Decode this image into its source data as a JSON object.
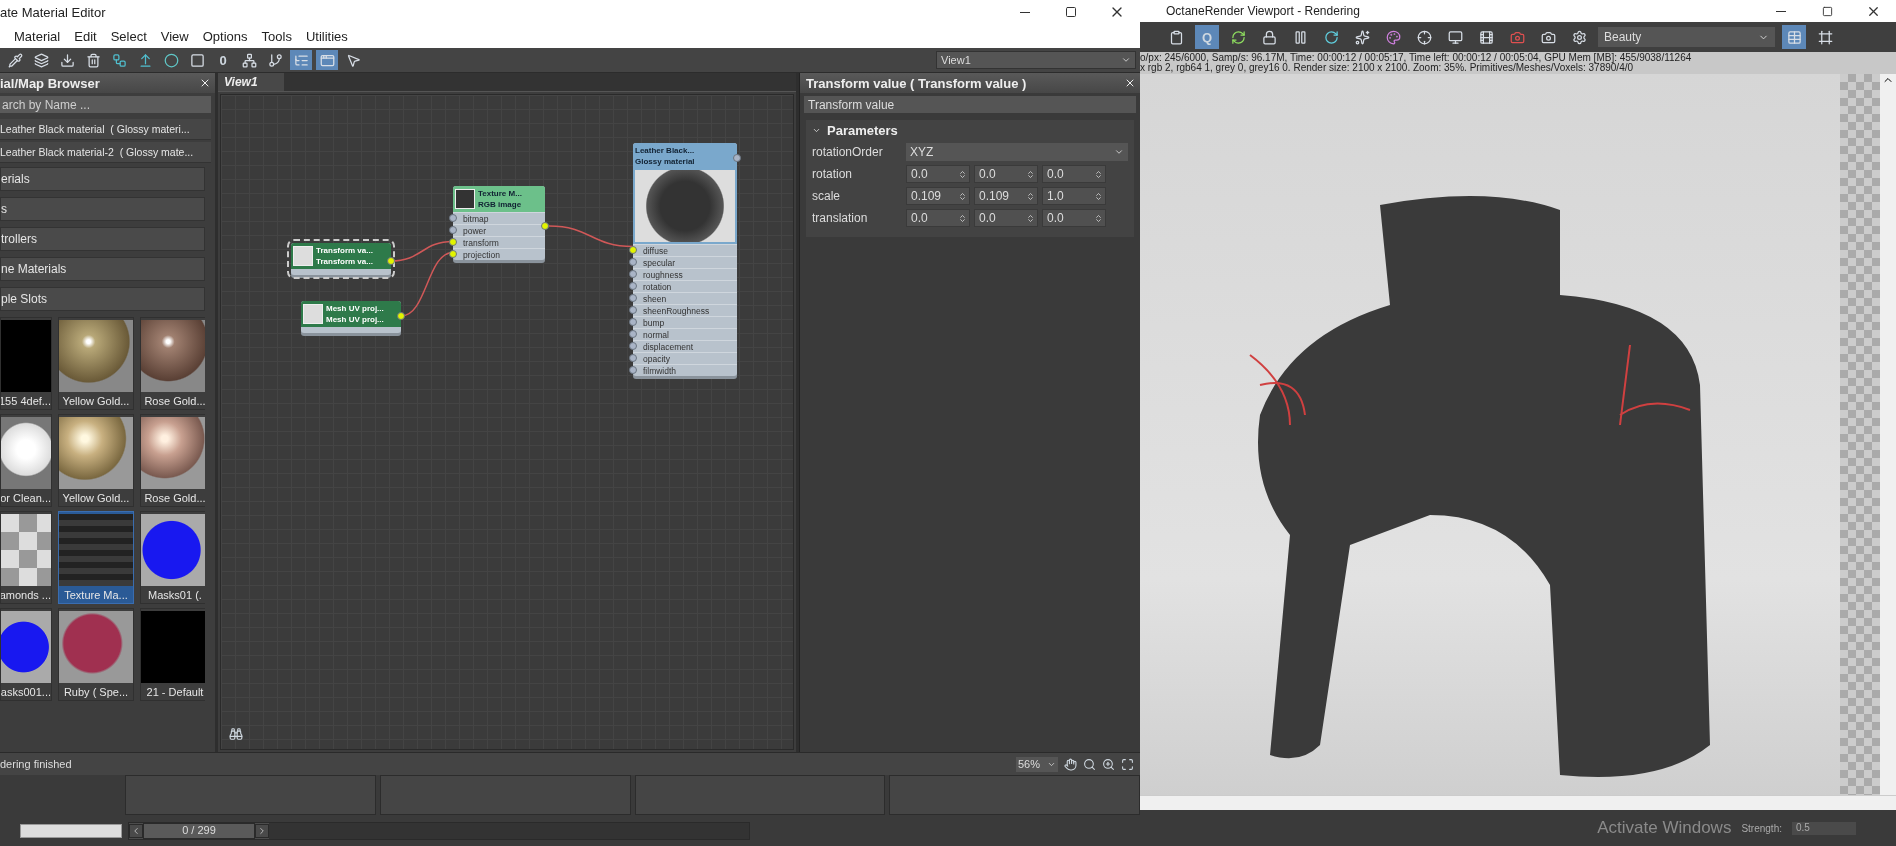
{
  "editor": {
    "title": "ate Material Editor",
    "menu": [
      "Material",
      "Edit",
      "Select",
      "View",
      "Options",
      "Tools",
      "Utilities"
    ],
    "toolbar": [
      {
        "kind": "pipette",
        "selected": false
      },
      {
        "kind": "layers",
        "selected": false
      },
      {
        "kind": "put",
        "selected": false
      },
      {
        "kind": "trash",
        "selected": false
      },
      {
        "kind": "layout",
        "selected": false
      },
      {
        "kind": "lift",
        "selected": false
      },
      {
        "kind": "sphere",
        "selected": false
      },
      {
        "kind": "dark",
        "selected": false
      },
      {
        "kind": "zero",
        "label": "0",
        "selected": false
      },
      {
        "kind": "nodes",
        "selected": false
      },
      {
        "kind": "branch",
        "selected": false
      },
      {
        "kind": "list",
        "selected": true
      },
      {
        "kind": "window",
        "selected": true
      },
      {
        "kind": "checker",
        "selected": false
      }
    ],
    "view_select": "View1",
    "browser": {
      "title": "ial/Map Browser",
      "placeholder": "arch by Name ...",
      "items": [
        "Leather Black material  ( Glossy materi...",
        "Leather Black material-2  ( Glossy mate..."
      ],
      "rollouts": [
        "erials",
        "s",
        "trollers",
        "ne Materials",
        "ple Slots"
      ],
      "slots": [
        {
          "label": "155 4def...",
          "kind": "black",
          "selected": false
        },
        {
          "label": "Yellow Gold...",
          "kind": "gold-chrome",
          "selected": false
        },
        {
          "label": "Rose Gold...",
          "kind": "rose-chrome",
          "selected": false
        },
        {
          "label": "or Clean...",
          "kind": "white",
          "selected": false
        },
        {
          "label": "Yellow Gold...",
          "kind": "gold",
          "selected": false
        },
        {
          "label": "Rose Gold...",
          "kind": "rose",
          "selected": false
        },
        {
          "label": "amonds ...",
          "kind": "glass",
          "selected": false
        },
        {
          "label": "Texture Ma...",
          "kind": "texture",
          "selected": true
        },
        {
          "label": "Masks01 (.",
          "kind": "blue",
          "selected": false
        },
        {
          "label": "asks001...",
          "kind": "blue",
          "selected": false
        },
        {
          "label": "Ruby ( Spe...",
          "kind": "ruby",
          "selected": false
        },
        {
          "label": "21 - Default",
          "kind": "black",
          "selected": false
        }
      ]
    },
    "node_view": {
      "tab": "View1",
      "nodes": [
        {
          "kind": "map",
          "selected": true,
          "title": "Transform va...",
          "subtitle": "Transform va..."
        },
        {
          "kind": "map",
          "selected": false,
          "title": "Mesh UV proj...",
          "subtitle": "Mesh UV proj..."
        },
        {
          "kind": "texture",
          "selected": false,
          "title": "Texture M...",
          "subtitle": "RGB image",
          "ports": [
            {
              "label": "bitmap",
              "connected": false
            },
            {
              "label": "power",
              "connected": false
            },
            {
              "label": "transform",
              "connected": true
            },
            {
              "label": "projection",
              "connected": true
            }
          ]
        },
        {
          "kind": "material",
          "selected": false,
          "title": "Leather Black...",
          "subtitle": "Glossy material",
          "ports": [
            {
              "label": "diffuse",
              "connected": true
            },
            {
              "label": "specular",
              "connected": false
            },
            {
              "label": "roughness",
              "connected": false
            },
            {
              "label": "rotation",
              "connected": false
            },
            {
              "label": "sheen",
              "connected": false
            },
            {
              "label": "sheenRoughness",
              "connected": false
            },
            {
              "label": "bump",
              "connected": false
            },
            {
              "label": "normal",
              "connected": false
            },
            {
              "label": "displacement",
              "connected": false
            },
            {
              "label": "opacity",
              "connected": false
            },
            {
              "label": "filmwidth",
              "connected": false
            }
          ]
        }
      ]
    },
    "panel": {
      "title": "Transform value  ( Transform value )",
      "name": "Transform value",
      "rollout": {
        "title": "Parameters",
        "expanded": true
      },
      "rows": [
        {
          "label": "rotationOrder",
          "kind": "dropdown",
          "value": "XYZ"
        },
        {
          "label": "rotation",
          "kind": "spinners",
          "values": [
            "0.0",
            "0.0",
            "0.0"
          ]
        },
        {
          "label": "scale",
          "kind": "spinners",
          "values": [
            "0.109",
            "0.109",
            "1.0"
          ]
        },
        {
          "label": "translation",
          "kind": "spinners",
          "values": [
            "0.0",
            "0.0",
            "0.0"
          ]
        }
      ]
    },
    "status_bar": {
      "message": "dering finished",
      "zoom": "56%"
    },
    "timeline": {
      "frame": "0 / 299",
      "level": 0
    }
  },
  "octane": {
    "title": "OctaneRender Viewport - Rendering",
    "toolbar": [
      {
        "kind": "clipboard",
        "selected": false
      },
      {
        "kind": "letter",
        "label": "Q",
        "selected": true
      },
      {
        "kind": "refresh",
        "selected": false
      },
      {
        "kind": "lock",
        "selected": false
      },
      {
        "kind": "pause",
        "selected": false
      },
      {
        "kind": "rotate",
        "selected": false
      },
      {
        "kind": "sparkle",
        "selected": false
      },
      {
        "kind": "palette",
        "selected": false
      },
      {
        "kind": "target",
        "selected": false
      },
      {
        "kind": "monitor",
        "selected": false
      },
      {
        "kind": "film",
        "selected": false
      },
      {
        "kind": "camera-red",
        "selected": false
      },
      {
        "kind": "camera",
        "selected": false
      },
      {
        "kind": "settings",
        "selected": false
      }
    ],
    "pass": "Beauty",
    "toggles": [
      {
        "kind": "table",
        "selected": true
      },
      {
        "kind": "region",
        "selected": false
      }
    ],
    "info": [
      "o/px: 245/6000,   Samp/s: 96.17M,   Time: 00:00:12 / 00:05:17,   Time left: 00:00:12 / 00:05:04,   GPU Mem [MB]: 455/9038/11264",
      "x rgb 2, rgb64 1, grey 0, grey16 0.   Render size: 2100 x 2100.   Zoom: 35%.   Primitives/Meshes/Voxels: 37890/4/0"
    ]
  },
  "taskbar": {
    "notice": "Activate Windows",
    "strength_label": "Strength:",
    "strength_value": "0.5"
  }
}
